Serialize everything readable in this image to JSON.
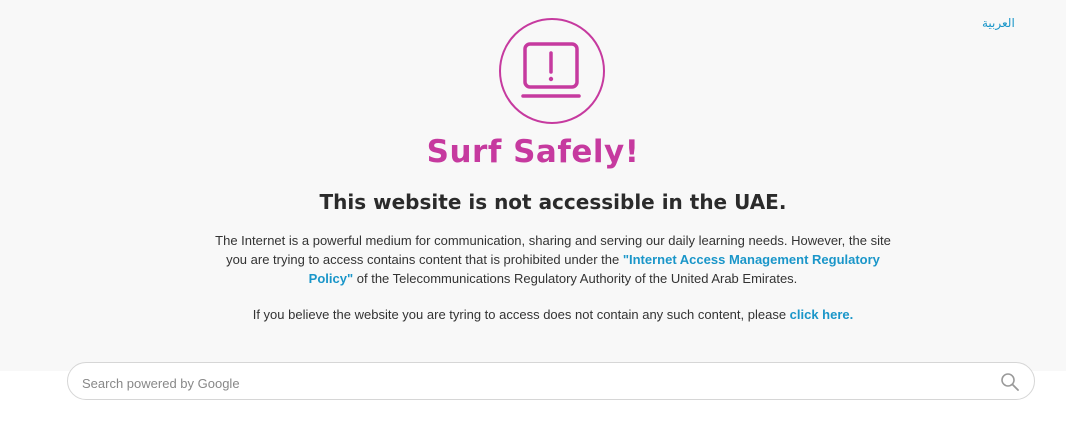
{
  "header": {
    "language_link": "العربية"
  },
  "hero": {
    "title": "Surf Safely!",
    "subtitle": "This website is not accessible in the UAE."
  },
  "message": {
    "paragraph_before_link": "The Internet is a powerful medium for communication, sharing and serving our daily learning needs. However, the site you are trying to access contains content that is prohibited under the ",
    "policy_link": "\"Internet Access Management Regulatory Policy\"",
    "paragraph_after_link": " of the Telecommunications Regulatory Authority of the United Arab Emirates.",
    "believe_text": "If you believe the website you are tyring to access does not contain any such content, please ",
    "click_here": "click here."
  },
  "search": {
    "placeholder": "Search powered by Google",
    "value": ""
  },
  "colors": {
    "accent": "#c63a9f",
    "link": "#1a96c9",
    "background": "#f8f8f8"
  },
  "icons": {
    "hero": "laptop-warning-icon",
    "search": "search-icon"
  }
}
